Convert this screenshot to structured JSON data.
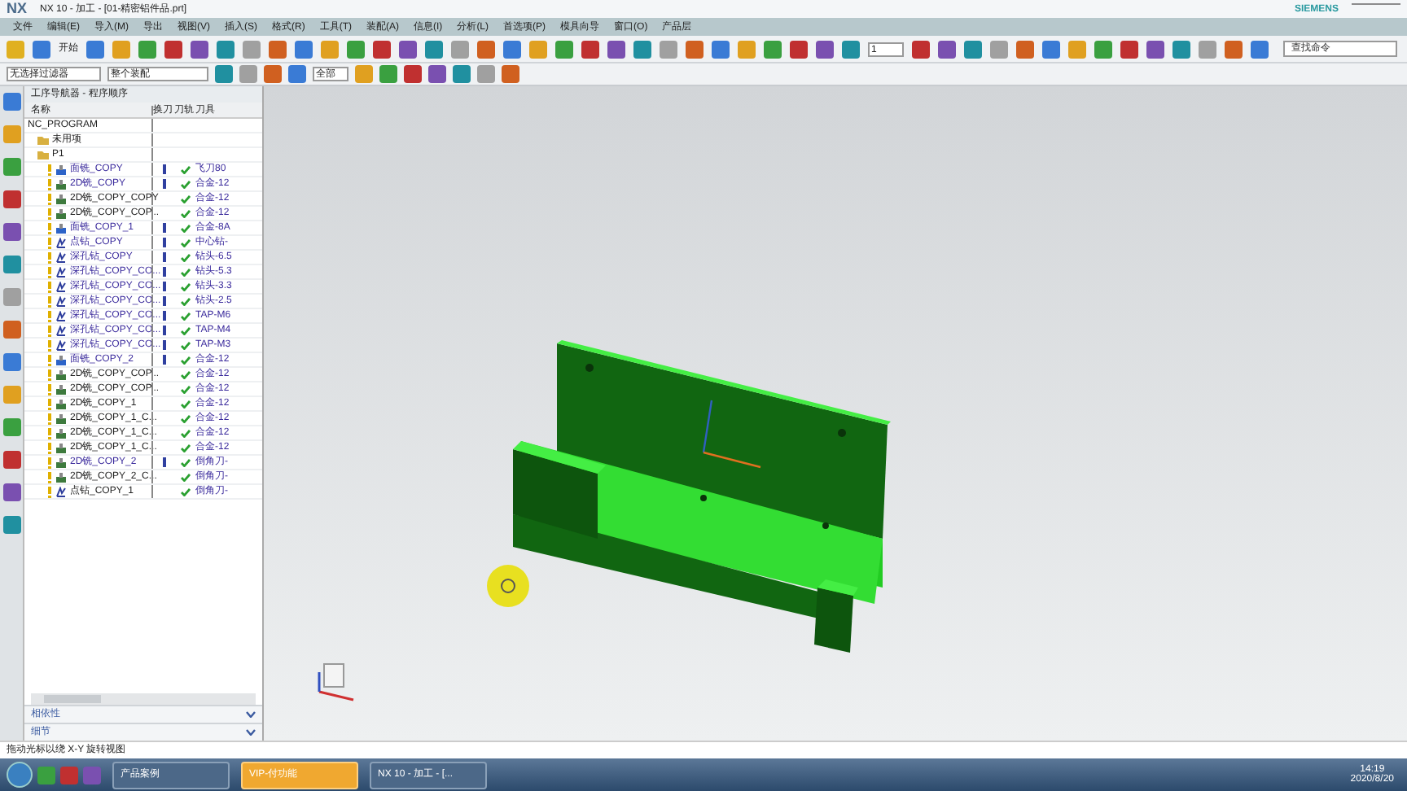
{
  "window": {
    "logo": "NX",
    "title": "NX 10 - 加工 - [01-精密铝件品.prt]",
    "brand": "SIEMENS"
  },
  "menu": [
    "文件",
    "编辑(E)",
    "导入(M)",
    "导出",
    "视图(V)",
    "插入(S)",
    "格式(R)",
    "工具(T)",
    "装配(A)",
    "信息(I)",
    "分析(L)",
    "首选项(P)",
    "模具向导",
    "窗口(O)",
    "产品层"
  ],
  "toolbar": {
    "start": "开始",
    "layer": "1",
    "search_placeholder": "查找命令"
  },
  "selection_bar": {
    "filter": "无选择过滤器",
    "assembly": "整个装配",
    "scope": "全部"
  },
  "navigator": {
    "title": "工序导航器 - 程序顺序",
    "columns": [
      "名称",
      "换刀",
      "刀轨",
      "刀具"
    ],
    "tree": [
      {
        "name": "NC_PROGRAM",
        "kind": "root",
        "children": [
          {
            "name": "未用项",
            "kind": "group"
          },
          {
            "name": "P1",
            "kind": "group",
            "children": [
              {
                "name": "面铣_COPY",
                "kind": "face",
                "tool_change": true,
                "path_ok": true,
                "tool": "飞刀80"
              },
              {
                "name": "2D铣_COPY",
                "kind": "planar",
                "tool_change": true,
                "path_ok": true,
                "tool": "合金-12"
              },
              {
                "name": "2D铣_COPY_COPY",
                "kind": "planar",
                "tool_change": false,
                "path_ok": true,
                "tool": "合金-12"
              },
              {
                "name": "2D铣_COPY_COP...",
                "kind": "planar",
                "tool_change": false,
                "path_ok": true,
                "tool": "合金-12"
              },
              {
                "name": "面铣_COPY_1",
                "kind": "face",
                "tool_change": true,
                "path_ok": true,
                "tool": "合金-8A"
              },
              {
                "name": "点钻_COPY",
                "kind": "drill",
                "tool_change": true,
                "path_ok": true,
                "tool": "中心钻-"
              },
              {
                "name": "深孔钻_COPY",
                "kind": "drill",
                "tool_change": true,
                "path_ok": true,
                "tool": "钻头-6.5"
              },
              {
                "name": "深孔钻_COPY_CO...",
                "kind": "drill",
                "tool_change": true,
                "path_ok": true,
                "tool": "钻头-5.3"
              },
              {
                "name": "深孔钻_COPY_CO...",
                "kind": "drill",
                "tool_change": true,
                "path_ok": true,
                "tool": "钻头-3.3"
              },
              {
                "name": "深孔钻_COPY_CO...",
                "kind": "drill",
                "tool_change": true,
                "path_ok": true,
                "tool": "钻头-2.5"
              },
              {
                "name": "深孔钻_COPY_CO...",
                "kind": "drill",
                "tool_change": true,
                "path_ok": true,
                "tool": "TAP-M6"
              },
              {
                "name": "深孔钻_COPY_CO...",
                "kind": "drill",
                "tool_change": true,
                "path_ok": true,
                "tool": "TAP-M4"
              },
              {
                "name": "深孔钻_COPY_CO...",
                "kind": "drill",
                "tool_change": true,
                "path_ok": true,
                "tool": "TAP-M3"
              },
              {
                "name": "面铣_COPY_2",
                "kind": "face",
                "tool_change": true,
                "path_ok": true,
                "tool": "合金-12"
              },
              {
                "name": "2D铣_COPY_COP...",
                "kind": "planar",
                "tool_change": false,
                "path_ok": true,
                "tool": "合金-12"
              },
              {
                "name": "2D铣_COPY_COP...",
                "kind": "planar",
                "tool_change": false,
                "path_ok": true,
                "tool": "合金-12"
              },
              {
                "name": "2D铣_COPY_1",
                "kind": "planar",
                "tool_change": false,
                "path_ok": true,
                "tool": "合金-12"
              },
              {
                "name": "2D铣_COPY_1_C...",
                "kind": "planar",
                "tool_change": false,
                "path_ok": true,
                "tool": "合金-12"
              },
              {
                "name": "2D铣_COPY_1_C...",
                "kind": "planar",
                "tool_change": false,
                "path_ok": true,
                "tool": "合金-12"
              },
              {
                "name": "2D铣_COPY_1_C...",
                "kind": "planar",
                "tool_change": false,
                "path_ok": true,
                "tool": "合金-12"
              },
              {
                "name": "2D铣_COPY_2",
                "kind": "planar",
                "tool_change": true,
                "path_ok": true,
                "tool": "倒角刀-"
              },
              {
                "name": "2D铣_COPY_2_C...",
                "kind": "planar",
                "tool_change": false,
                "path_ok": true,
                "tool": "倒角刀-"
              },
              {
                "name": "点钻_COPY_1",
                "kind": "drill",
                "tool_change": false,
                "path_ok": true,
                "tool": "倒角刀-"
              }
            ]
          }
        ]
      }
    ],
    "panels": [
      {
        "label": "相依性",
        "expanded": false
      },
      {
        "label": "细节",
        "expanded": false
      }
    ]
  },
  "status_bar": "拖动光标以绕 X-Y 旋转视图",
  "taskbar": {
    "apps": [
      {
        "label": "产品案例",
        "selected": false
      },
      {
        "label": "VIP-付功能",
        "selected": true
      },
      {
        "label": "NX 10 - 加工 - [...",
        "selected": false
      }
    ],
    "time": "14:19",
    "date": "2020/8/20"
  }
}
